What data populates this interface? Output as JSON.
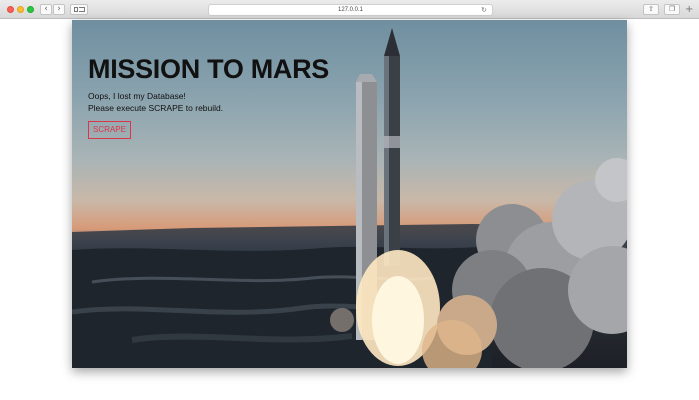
{
  "browser": {
    "address": "127.0.0.1",
    "icons": [
      "back-icon",
      "forward-icon",
      "sidebar-icon",
      "reload-icon",
      "share-icon",
      "tabs-icon",
      "new-tab-icon"
    ]
  },
  "hero": {
    "title": "MISSION TO MARS",
    "line1": "Oops, I lost my Database!",
    "line2": "Please execute SCRAPE to rebuild.",
    "button_label": "SCRAPE",
    "accent_color": "#dc3545"
  }
}
